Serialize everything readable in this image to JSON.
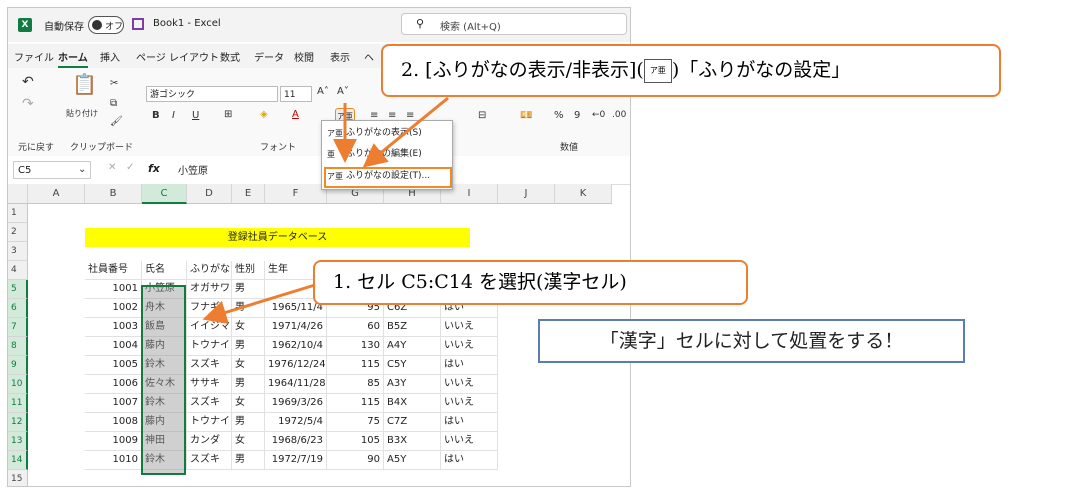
{
  "titlebar": {
    "logo": "X",
    "autosave_label": "自動保存",
    "autosave_state": "オフ",
    "document_title": "Book1  -  Excel",
    "search_placeholder": "検索 (Alt+Q)"
  },
  "tabs": [
    "ファイル",
    "ホーム",
    "挿入",
    "ページ レイアウト",
    "数式",
    "データ",
    "校閲",
    "表示",
    "ヘ"
  ],
  "ribbon": {
    "font_name": "游ゴシック",
    "font_size": "11",
    "groups": {
      "undo": "元に戻す",
      "clipboard": "クリップボード",
      "font": "フォント",
      "number": "数値"
    },
    "paste_label": "貼り付け",
    "bold": "B",
    "italic": "I",
    "underline": "U",
    "grow": "A˄",
    "shrink": "A˅",
    "percent": "%",
    "comma": "9"
  },
  "furigana_menu": [
    {
      "glyph": "ア亜",
      "label": "ふりがなの表示(S)"
    },
    {
      "glyph": "亜",
      "label": "ふりがなの編集(E)"
    },
    {
      "glyph": "ア亜",
      "label": "ふりがなの設定(T)..."
    }
  ],
  "formula_bar": {
    "name_box": "C5",
    "value": "小笠原"
  },
  "columns": [
    "A",
    "B",
    "C",
    "D",
    "E",
    "F",
    "G",
    "H",
    "I",
    "J",
    "K"
  ],
  "rows": [
    "1",
    "2",
    "3",
    "4",
    "5",
    "6",
    "7",
    "8",
    "9",
    "10",
    "11",
    "12",
    "13",
    "14",
    "15"
  ],
  "sheet": {
    "title": "登録社員データベース",
    "headers": [
      "社員番号",
      "氏名",
      "ふりがな",
      "性別",
      "生年"
    ],
    "records": [
      {
        "id": "1001",
        "name": "小笠原",
        "kana": "オガサワラ",
        "sex": "男",
        "dob": "",
        "g": "",
        "h": "",
        "i": ""
      },
      {
        "id": "1002",
        "name": "舟木",
        "kana": "フナギ",
        "sex": "男",
        "dob": "1965/11/4",
        "g": "95",
        "h": "C6Z",
        "i": "はい"
      },
      {
        "id": "1003",
        "name": "飯島",
        "kana": "イイジマ",
        "sex": "女",
        "dob": "1971/4/26",
        "g": "60",
        "h": "B5Z",
        "i": "いいえ"
      },
      {
        "id": "1004",
        "name": "藤内",
        "kana": "トウナイ",
        "sex": "男",
        "dob": "1962/10/4",
        "g": "130",
        "h": "A4Y",
        "i": "いいえ"
      },
      {
        "id": "1005",
        "name": "鈴木",
        "kana": "スズキ",
        "sex": "女",
        "dob": "1976/12/24",
        "g": "115",
        "h": "C5Y",
        "i": "はい"
      },
      {
        "id": "1006",
        "name": "佐々木",
        "kana": "ササキ",
        "sex": "男",
        "dob": "1964/11/28",
        "g": "85",
        "h": "A3Y",
        "i": "いいえ"
      },
      {
        "id": "1007",
        "name": "鈴木",
        "kana": "スズキ",
        "sex": "女",
        "dob": "1969/3/26",
        "g": "115",
        "h": "B4X",
        "i": "いいえ"
      },
      {
        "id": "1008",
        "name": "藤内",
        "kana": "トウナイ",
        "sex": "男",
        "dob": "1972/5/4",
        "g": "75",
        "h": "C7Z",
        "i": "はい"
      },
      {
        "id": "1009",
        "name": "神田",
        "kana": "カンダ",
        "sex": "女",
        "dob": "1968/6/23",
        "g": "105",
        "h": "B3X",
        "i": "いいえ"
      },
      {
        "id": "1010",
        "name": "鈴木",
        "kana": "スズキ",
        "sex": "男",
        "dob": "1972/7/19",
        "g": "90",
        "h": "A5Y",
        "i": "はい"
      }
    ]
  },
  "annotations": {
    "step2": "2.  [ふりがなの表示/非表示](",
    "step2_tail": ")「ふりがなの設定」",
    "step2_icon": "ア亜",
    "step1": "1.  セル C5:C14 を選択(漢字セル)",
    "note": "「漢字」セルに対して処置をする！"
  },
  "colors": {
    "excel_green": "#107c41",
    "callout_orange": "#ed7d31",
    "note_blue": "#5b7db1",
    "title_yellow": "#ffff00"
  }
}
